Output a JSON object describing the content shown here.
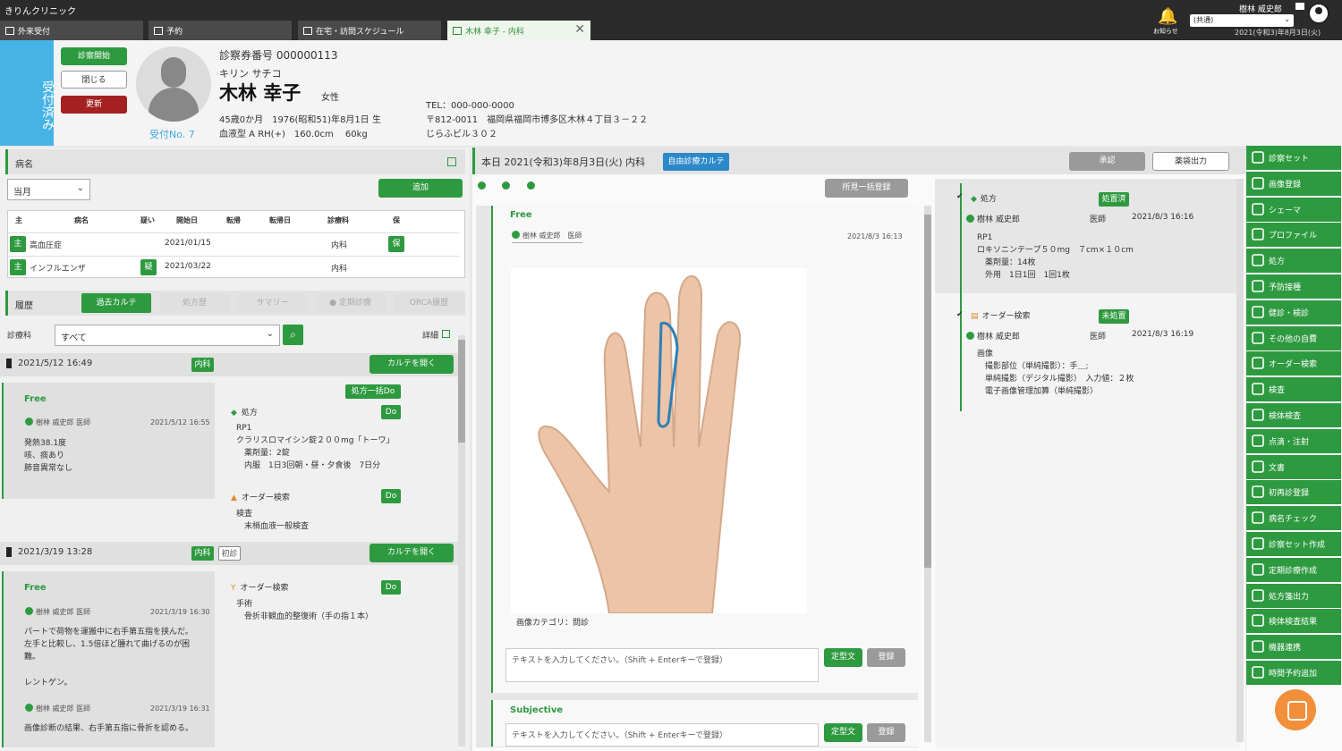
{
  "app": {
    "clinic_name": "きりんクリニック"
  },
  "tabs": [
    {
      "label": "外来受付"
    },
    {
      "label": "予約"
    },
    {
      "label": "在宅・訪問スケジュール"
    },
    {
      "label": "木林 幸子 - 内科"
    }
  ],
  "topright": {
    "notify_label": "お知らせ",
    "doctor": "樹林 威史郎",
    "dept_selected": "(共通)",
    "date": "2021(令和3)年8月3日(火)"
  },
  "status_strip": "受付済み",
  "header_buttons": {
    "start": "診察開始",
    "close": "閉じる",
    "update": "更新"
  },
  "patient": {
    "reception_no": "受付No. 7",
    "card_no": "診察券番号 000000113",
    "kana": "キリン サチコ",
    "name": "木林 幸子",
    "sex": "女性",
    "age_birth": "45歳0か月　1976(昭和51)年8月1日 生",
    "blood": "血液型 A RH(+)　160.0cm　 60kg",
    "tel": "TEL：000-000-0000",
    "addr1": "〒812-0011　福岡県福岡市博多区木林４丁目３－２２",
    "addr2": "じらふビル３０２"
  },
  "disease": {
    "title": "病名",
    "period": "当月",
    "add": "追加",
    "headers": [
      "主",
      "病名",
      "疑い",
      "開始日",
      "転帰",
      "転帰日",
      "診療科",
      "保"
    ],
    "rows": [
      {
        "main": "主",
        "name": "高血圧症",
        "suspect": "",
        "start": "2021/01/15",
        "dept": "内科",
        "ins": "保"
      },
      {
        "main": "主",
        "name": "インフルエンザ",
        "suspect": "疑",
        "start": "2021/03/22",
        "dept": "内科",
        "ins": ""
      }
    ]
  },
  "history": {
    "title": "履歴",
    "tabs": [
      "過去カルテ",
      "処方歴",
      "サマリー",
      "● 定期診療",
      "ORCA履歴"
    ],
    "dept_label": "診療科",
    "dept_value": "すべて",
    "detail": "詳細",
    "visits": [
      {
        "date": "2021/5/12 16:49",
        "dept": "内科",
        "open": "カルテを開く",
        "free_label": "Free",
        "author": "樹林 威史郎 医師",
        "time": "2021/5/12 16:55",
        "notes": [
          "発熱38.1度",
          "咳、痰あり",
          "肺音異常なし"
        ],
        "do_all": "処方一括Do",
        "rx_label": "処方",
        "do": "Do",
        "rx_lines": [
          "RP1",
          "クラリスロマイシン錠２００mg「トーワ」",
          "　薬剤量：2錠",
          "　内服　1日3回朝・昼・夕食後　7日分"
        ],
        "order_label": "オーダー検索",
        "order_lines": [
          "検査",
          "　末梢血液一般検査"
        ]
      },
      {
        "date": "2021/3/19 13:28",
        "dept": "内科",
        "first": "初診",
        "open": "カルテを開く",
        "free_label": "Free",
        "author": "樹林 威史郎 医師",
        "time": "2021/3/19 16:30",
        "notes": [
          "パートで荷物を運搬中に右手第五指を挟んだ。",
          "左手と比較し、1.5倍ほど腫れて曲げるのが困",
          "難。",
          "",
          "レントゲン。"
        ],
        "author2": "樹林 威史郎 医師",
        "time2": "2021/3/19 16:31",
        "notes2": [
          "画像診断の結果、右手第五指に骨折を認める。"
        ],
        "order_label": "オーダー検索",
        "order_lines": [
          "手術",
          "　骨折非観血的整復術（手の指１本）"
        ]
      }
    ]
  },
  "today": {
    "title": "本日 2021(令和3)年8月3日(火) 内科",
    "badge": "自由診療カルテ",
    "approve": "承認",
    "medicine_bag": "薬袋出力",
    "bulk_register": "所見一括登録",
    "free_label": "Free",
    "author": "樹林 威史郎　医師",
    "time": "2021/8/3 16:13",
    "image_category": "画像カテゴリ：問診",
    "input_placeholder": "テキストを入力してください。（Shift + Enterキーで登録）",
    "template_btn": "定型文",
    "register_btn": "登録",
    "subjective_label": "Subjective"
  },
  "orders": [
    {
      "label": "処方",
      "status": "処置済",
      "author": "樹林 威史郎",
      "role": "医師",
      "time": "2021/8/3 16:16",
      "lines": [
        "RP1",
        "ロキソニンテープ５０mg　７cm×１０cm",
        "　薬剤量：14枚",
        "　外用　1日1回　1回1枚"
      ]
    },
    {
      "label": "オーダー検索",
      "status": "未処置",
      "author": "樹林 威史郎",
      "role": "医師",
      "time": "2021/8/3 16:19",
      "lines": [
        "画像",
        "　撮影部位（単純撮影）：手＿;",
        "　単純撮影（デジタル撮影）　入力値：２枚",
        "　電子画像管理加算（単純撮影）"
      ]
    }
  ],
  "side_menu": [
    "診察セット",
    "画像登録",
    "シェーマ",
    "プロファイル",
    "処方",
    "予防接種",
    "健診・検診",
    "その他の自費",
    "オーダー検索",
    "検査",
    "検体検査",
    "点滴・注射",
    "文書",
    "初再診登録",
    "病名チェック",
    "診察セット作成",
    "定期診療作成",
    "処方箋出力",
    "検体検査結果",
    "機器連携",
    "時間予約追加"
  ],
  "colors": {
    "accent": "#2e9a40",
    "status_blue": "#46b3e6",
    "update_red": "#a32121",
    "topbar": "#2b2b2b"
  }
}
